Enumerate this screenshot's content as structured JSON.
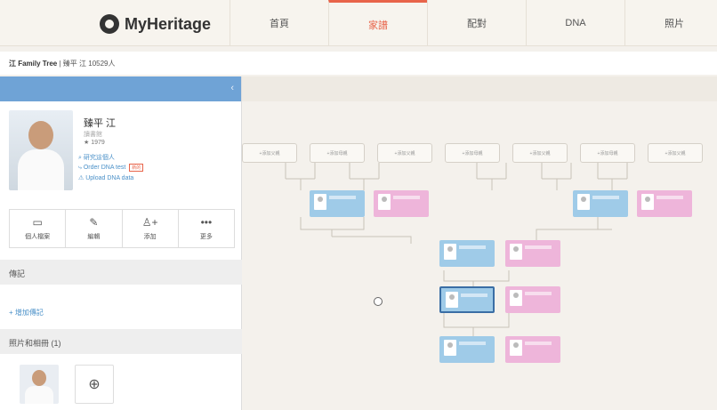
{
  "header": {
    "logo": "MyHeritage",
    "nav": [
      "首頁",
      "家譜",
      "配對",
      "DNA",
      "照片"
    ],
    "active_index": 1,
    "accent": "#e8644a"
  },
  "breadcrumb": {
    "tree_name": "江 Family Tree",
    "separator": "|",
    "detail": "臻平 江  10529人"
  },
  "sidebar": {
    "collapse_glyph": "‹",
    "person": {
      "name": "臻平 江",
      "subtitle": "讀書館",
      "birth": "★ 1979",
      "link_research": "⌕ 研究這個人",
      "link_dna": "⤷ Order DNA test",
      "dna_badge": "新的",
      "link_upload": "⚠ Upload DNA data"
    },
    "actions": [
      {
        "icon": "profile-card-icon",
        "glyph": "▭",
        "label": "個人檔案"
      },
      {
        "icon": "pencil-icon",
        "glyph": "✎",
        "label": "編輯"
      },
      {
        "icon": "add-person-icon",
        "glyph": "♙+",
        "label": "添加"
      },
      {
        "icon": "more-icon",
        "glyph": "•••",
        "label": "更多"
      }
    ],
    "bio_section": "傳記",
    "add_bio": "+ 增加傳記",
    "photos_section": "照片和相冊 (1)",
    "camera_glyph": "⊕"
  },
  "colors": {
    "male": "#9fcbe8",
    "female": "#eeb5da",
    "sidebar_header": "#6fa3d6"
  }
}
